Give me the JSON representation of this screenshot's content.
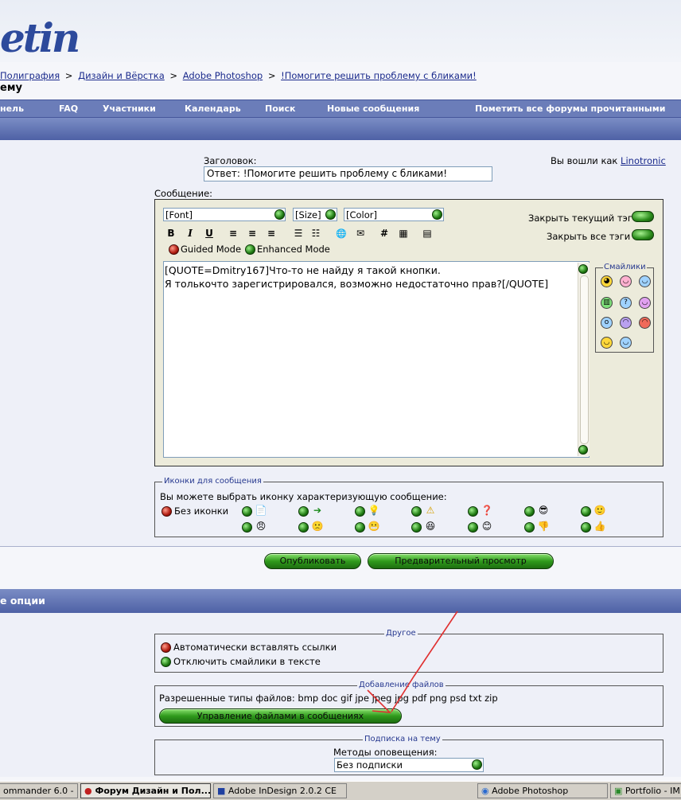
{
  "header": {
    "logo_text": "etin",
    "breadcrumb": [
      "Полиграфия",
      ">",
      "Дизайн и Вёрстка",
      ">",
      "Adobe Photoshop",
      ">",
      "!Помогите решить проблему с бликами!"
    ],
    "page_title": "ему"
  },
  "navbar": {
    "items": [
      "нель",
      "FAQ",
      "Участники",
      "Календарь",
      "Поиск",
      "Новые сообщения",
      "Пометить все форумы прочитанными"
    ]
  },
  "form": {
    "title_label": "Заголовок:",
    "title_value": "Ответ: !Помогите решить проблему с бликами!",
    "logged_in_text": "Вы вошли как",
    "username": "Linotronic",
    "message_label": "Сообщение:"
  },
  "editor": {
    "font_select": "[Font]",
    "size_select": "[Size]",
    "color_select": "[Color]",
    "close_tag_label": "Закрыть текущий тэг",
    "close_all_label": "Закрыть все тэги",
    "guided_mode": "Guided Mode",
    "enhanced_mode": "Enhanced Mode",
    "toolbar": [
      "B",
      "I",
      "U",
      "≡",
      "≡",
      "≡",
      "☰",
      "☷",
      "🌐",
      "✉",
      "#",
      "▦",
      "▤"
    ],
    "message_line1": "[QUOTE=Dmitry167]Что-то не найду я такой кнопки.",
    "message_line2": "Я толькочто зарегистрировался, возможно недостаточно прав?[/QUOTE]",
    "smilies_label": "Смайлики"
  },
  "icons_section": {
    "legend": "Иконки для сообщения",
    "hint": "Вы можете выбрать иконку характеризующую сообщение:",
    "no_icon_label": "Без иконки"
  },
  "buttons": {
    "publish": "Опубликовать",
    "preview": "Предварительный просмотр"
  },
  "options": {
    "header": "е опции",
    "other_legend": "Другое",
    "auto_links": "Автоматически вставлять ссылки",
    "disable_smilies": "Отключить смайлики в тексте",
    "attach_legend": "Добавление файлов",
    "allowed_types": "Разрешенные типы файлов: bmp doc gif jpe jpeg jpg pdf png psd txt zip",
    "manage_files": "Управление файлами в сообщениях",
    "subscribe_legend": "Подписка на тему",
    "notify_methods": "Методы оповещения:",
    "notify_value": "Без подписки"
  },
  "taskbar": {
    "items": [
      "ommander 6.0 -",
      "Форум Дизайн и Пол...",
      "Adobe InDesign 2.0.2 CE",
      "Adobe Photoshop",
      "Portfolio - IM"
    ]
  },
  "colors": {
    "nav": "#6b7db9",
    "band": "#4e61a5",
    "link": "#1a2a8c",
    "green_button": "#2f9a1c",
    "annotation": "#e03030"
  }
}
